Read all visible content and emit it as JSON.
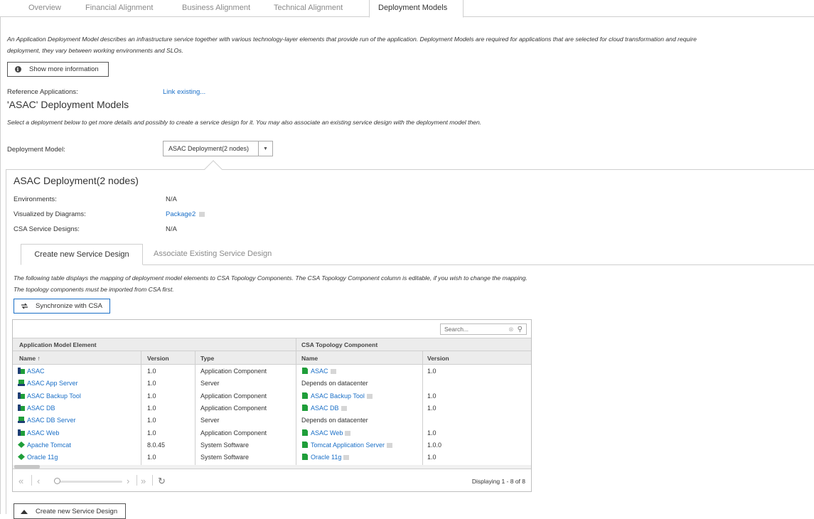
{
  "top_tabs": [
    "Overview",
    "Financial Alignment",
    "Business Alignment",
    "Technical Alignment",
    "Deployment Models"
  ],
  "intro": {
    "line1": "An Application Deployment Model describes an infrastructure service together with various technology-layer elements that provide run of the application. Deployment Models are required for applications that are selected for cloud transformation and require",
    "line2": "deployment, they vary between working environments and SLOs."
  },
  "show_more_label": "Show more information",
  "reference_apps": {
    "label": "Reference Applications:",
    "link": "Link existing..."
  },
  "section_title": "'ASAC' Deployment Models",
  "section_desc": "Select a deployment below to get more details and possibly to create a service design for it. You may also associate an existing service design with the deployment model then.",
  "deployment_model": {
    "label": "Deployment Model:",
    "selected": "ASAC Deployment(2 nodes)"
  },
  "panel": {
    "title": "ASAC Deployment(2 nodes)",
    "props": [
      {
        "label": "Environments:",
        "value": "N/A"
      },
      {
        "label": "Visualized by Diagrams:",
        "value": "Package2"
      },
      {
        "label": "CSA Service Designs:",
        "value": "N/A"
      }
    ],
    "tabs": [
      "Create new Service Design",
      "Associate Existing Service Design"
    ],
    "desc1": "The following table displays the mapping of deployment model elements to CSA Topology Components. The CSA Topology Component column is editable, if you wish to change the mapping.",
    "desc2": "The topology components must be imported from CSA first.",
    "sync_label": "Synchronize with CSA"
  },
  "grid": {
    "search_placeholder": "Search...",
    "group_headers": [
      "Application Model Element",
      "CSA Topology Component"
    ],
    "columns": [
      "Name ↑",
      "Version",
      "Type",
      "Name",
      "Version"
    ],
    "rows": [
      {
        "name": "ASAC",
        "ver": "1.0",
        "type": "Application Component",
        "icon": "app",
        "csa_name": "ASAC",
        "csa_link": true,
        "csa_ver": "1.0"
      },
      {
        "name": "ASAC App Server",
        "ver": "1.0",
        "type": "Server",
        "icon": "server",
        "csa_name": "Depends on datacenter",
        "csa_link": false,
        "csa_ver": ""
      },
      {
        "name": "ASAC Backup Tool",
        "ver": "1.0",
        "type": "Application Component",
        "icon": "app",
        "csa_name": "ASAC Backup Tool",
        "csa_link": true,
        "csa_ver": "1.0"
      },
      {
        "name": "ASAC DB",
        "ver": "1.0",
        "type": "Application Component",
        "icon": "app",
        "csa_name": "ASAC DB",
        "csa_link": true,
        "csa_ver": "1.0"
      },
      {
        "name": "ASAC DB Server",
        "ver": "1.0",
        "type": "Server",
        "icon": "server",
        "csa_name": "Depends on datacenter",
        "csa_link": false,
        "csa_ver": ""
      },
      {
        "name": "ASAC Web",
        "ver": "1.0",
        "type": "Application Component",
        "icon": "app",
        "csa_name": "ASAC Web",
        "csa_link": true,
        "csa_ver": "1.0"
      },
      {
        "name": "Apache Tomcat",
        "ver": "8.0.45",
        "type": "System Software",
        "icon": "software",
        "csa_name": "Tomcat Application Server",
        "csa_link": true,
        "csa_ver": "1.0.0"
      },
      {
        "name": "Oracle 11g",
        "ver": "1.0",
        "type": "System Software",
        "icon": "software",
        "csa_name": "Oracle 11g",
        "csa_link": true,
        "csa_ver": "1.0"
      }
    ],
    "displaying": "Displaying 1 - 8 of 8"
  },
  "create_button": "Create new Service Design",
  "colors": {
    "link": "#1a6fc7",
    "header_bg": "#ececec",
    "border": "#cfcfcf",
    "icon_green": "#1f9e3a",
    "icon_navy": "#1d3f73"
  }
}
